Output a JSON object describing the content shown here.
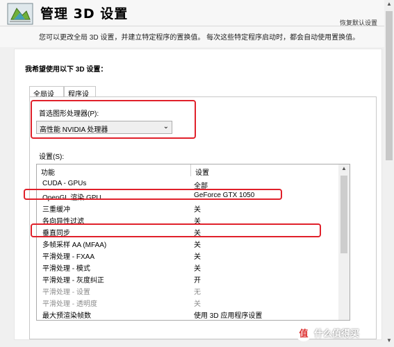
{
  "header": {
    "title": "管理 3D 设置",
    "restore_defaults": "恢复默认设置"
  },
  "description": "您可以更改全局 3D 设置，并建立特定程序的置换值。 每次这些特定程序启动时，都会自动使用置换值。",
  "section_title": "我希望使用以下 3D 设置：",
  "tabs": [
    "全局设置",
    "程序设置"
  ],
  "preferred_gpu": {
    "label": "首选图形处理器(P):",
    "value": "高性能 NVIDIA 处理器"
  },
  "settings": {
    "label": "设置(S):",
    "columns": [
      "功能",
      "设置"
    ],
    "rows": [
      {
        "feature": "CUDA - GPUs",
        "value": "全部"
      },
      {
        "feature": "OpenGL 渲染 GPU",
        "value": "GeForce GTX 1050"
      },
      {
        "feature": "三重缓冲",
        "value": "关"
      },
      {
        "feature": "各向异性过滤",
        "value": "关"
      },
      {
        "feature": "垂直同步",
        "value": "关"
      },
      {
        "feature": "多帧采样 AA (MFAA)",
        "value": "关"
      },
      {
        "feature": "平滑处理 - FXAA",
        "value": "关"
      },
      {
        "feature": "平滑处理 - 模式",
        "value": "关"
      },
      {
        "feature": "平滑处理 - 灰度纠正",
        "value": "开"
      },
      {
        "feature": "平滑处理 - 设置",
        "value": "无"
      },
      {
        "feature": "平滑处理 - 透明度",
        "value": "关"
      },
      {
        "feature": "最大预渲染帧数",
        "value": "使用 3D 应用程序设置"
      }
    ]
  },
  "watermark": {
    "badge": "值",
    "text": "什么值得买"
  },
  "colors": {
    "highlight": "#e0202a"
  }
}
